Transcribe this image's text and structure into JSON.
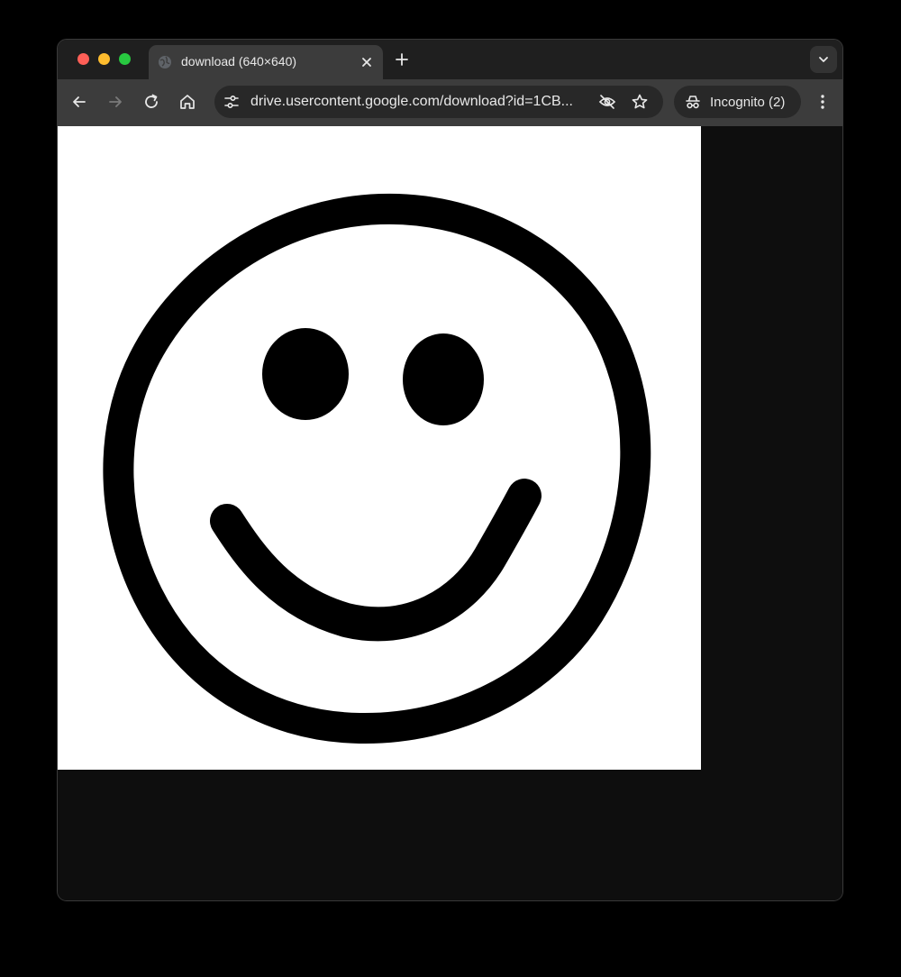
{
  "browser": {
    "tab": {
      "title": "download (640×640)",
      "favicon": "globe-icon"
    },
    "toolbar": {
      "url": "drive.usercontent.google.com/download?id=1CB...",
      "incognito_label": "Incognito (2)"
    },
    "icons": {
      "back": "arrow-left-icon",
      "forward": "arrow-right-icon",
      "reload": "reload-icon",
      "home": "home-icon",
      "site_settings": "tune-icon",
      "tracking": "eye-off-icon",
      "bookmark": "star-icon",
      "menu": "more-vert-icon",
      "tab_search": "chevron-down-icon"
    },
    "colors": {
      "traffic_close": "#ff5f57",
      "traffic_min": "#febc2e",
      "traffic_max": "#28c840",
      "toolbar_bg": "#3c3c3c",
      "tabstrip_bg": "#1f1f1f",
      "page_bg": "#0e0e0e"
    }
  },
  "content": {
    "image_subject": "smiley-face-icon",
    "image_bg": "#ffffff",
    "ink": "#000000"
  }
}
